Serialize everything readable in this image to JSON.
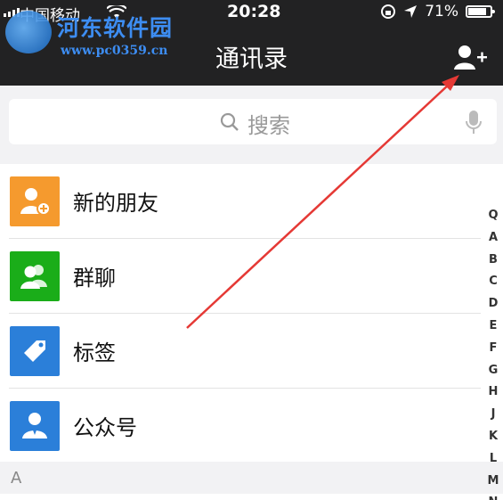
{
  "status": {
    "carrier": "中国移动",
    "time": "20:28",
    "battery": "71%"
  },
  "watermark": {
    "title": "河东软件园",
    "url": "www.pc0359.cn"
  },
  "header": {
    "title": "通讯录"
  },
  "search": {
    "placeholder": "搜索"
  },
  "list": [
    {
      "label": "新的朋友",
      "icon": "add-friend-icon",
      "color": "#f59a2e"
    },
    {
      "label": "群聊",
      "icon": "group-chat-icon",
      "color": "#1aad19"
    },
    {
      "label": "标签",
      "icon": "tag-icon",
      "color": "#2b7fd9"
    },
    {
      "label": "公众号",
      "icon": "official-account-icon",
      "color": "#2b7fd9"
    }
  ],
  "section": "A",
  "index": [
    "Q",
    "A",
    "B",
    "C",
    "D",
    "E",
    "F",
    "G",
    "H",
    "J",
    "K",
    "L",
    "M",
    "N"
  ],
  "colors": {
    "header_bg": "#222223",
    "annotation_arrow": "#e53935"
  }
}
